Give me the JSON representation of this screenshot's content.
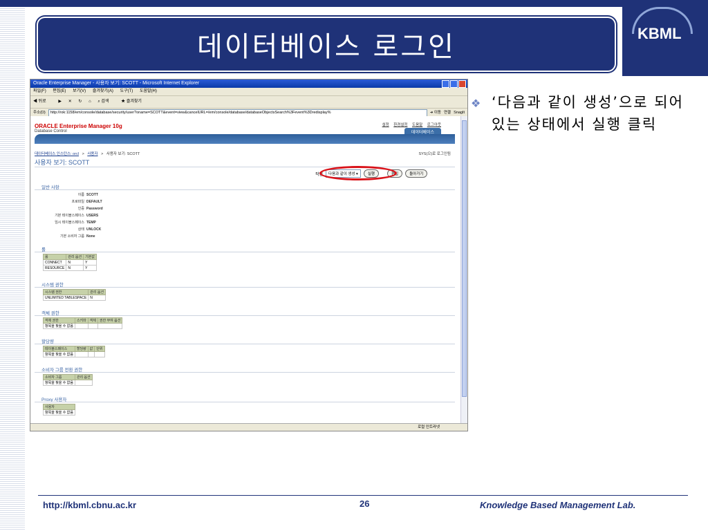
{
  "slide": {
    "title": "데이터베이스 로그인",
    "logo": "KBML",
    "bullet_icon": "diamond-bullet-icon",
    "bullet_text": "‘다음과 같이 생성’으로 되어 있는 상태에서 실행 클릭",
    "footer": {
      "url": "http://kbml.cbnu.ac.kr",
      "page": "26",
      "lab": "Knowledge Based Management Lab."
    }
  },
  "browser": {
    "window_title": "Oracle Enterprise Manager - 사용자 보기: SCOTT - Microsoft Internet Explorer",
    "menu": [
      "파일(F)",
      "편집(E)",
      "보기(V)",
      "즐겨찾기(A)",
      "도구(T)",
      "도움말(H)"
    ],
    "toolbar": [
      "뒤로",
      "검색",
      "즐겨찾기"
    ],
    "address_label": "주소(D)",
    "address": "http://rok:1158/em/console/database/security/user?oname=SCOTT&event=view&cancelURL=/em/console/database/databaseObjectsSearch%3Fevent%3Dredisplay%",
    "go_label": "이동",
    "links_label": "연결",
    "snagit": "SnagIt",
    "status_text": "로컬 인트라넷"
  },
  "em": {
    "brand": "ORACLE Enterprise Manager 10g",
    "subtitle": "Database Control",
    "top_links": [
      "설정",
      "환경설정",
      "도움말",
      "로그아웃"
    ],
    "db_tab": "데이터베이스",
    "breadcrumb": [
      "데이터베이스 인스턴스: orcl",
      ">",
      "사용자",
      ">",
      "사용자 보기: SCOTT"
    ],
    "login_info": "SYS(으)로 로그인됨",
    "page_title": "사용자 보기: SCOTT",
    "actions": {
      "label": "작업",
      "select_value": "다음과 같이 생성",
      "run": "실행",
      "edit": "편집",
      "back": "돌아가기"
    },
    "general": {
      "heading": "일반 사항",
      "rows": [
        {
          "k": "이름",
          "v": "SCOTT"
        },
        {
          "k": "프로파일",
          "v": "DEFAULT"
        },
        {
          "k": "인증",
          "v": "Password"
        },
        {
          "k": "기본 테이블스페이스",
          "v": "USERS"
        },
        {
          "k": "임시 테이블스페이스",
          "v": "TEMP"
        },
        {
          "k": "상태",
          "v": "UNLOCK"
        },
        {
          "k": "기본 소비자 그룹",
          "v": "None"
        }
      ]
    },
    "roles": {
      "heading": "롤",
      "headers": [
        "롤",
        "관리 옵션",
        "기본값"
      ],
      "rows": [
        [
          "CONNECT",
          "N",
          "Y"
        ],
        [
          "RESOURCE",
          "N",
          "Y"
        ]
      ]
    },
    "sys_priv": {
      "heading": "시스템 권한",
      "headers": [
        "시스템 권한",
        "관리 옵션"
      ],
      "rows": [
        [
          "UNLIMITED TABLESPACE",
          "N"
        ]
      ]
    },
    "obj_priv": {
      "heading": "객체 권한",
      "headers": [
        "객체 권한",
        "스키마",
        "객체",
        "권한 부여 옵션"
      ],
      "empty": "항목을 찾을 수 없음"
    },
    "quota": {
      "heading": "할당량",
      "headers": [
        "테이블스페이스",
        "할당량",
        "값",
        "단위"
      ],
      "empty": "항목을 찾을 수 없음"
    },
    "consumer": {
      "heading": "소비자 그룹 전환 권한",
      "headers": [
        "소비자 그룹",
        "관리 옵션"
      ],
      "empty": "항목을 찾을 수 없음"
    },
    "proxy": {
      "heading": "Proxy 사용자",
      "headers": [
        "사용자"
      ],
      "empty": "항목을 찾을 수 없음"
    }
  }
}
